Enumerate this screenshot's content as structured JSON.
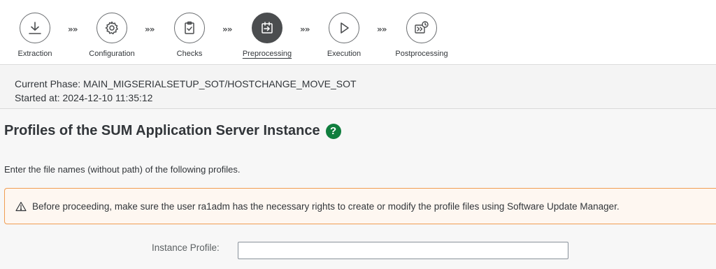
{
  "roadmap": {
    "steps": [
      {
        "label": "Extraction",
        "icon": "download-icon",
        "active": false
      },
      {
        "label": "Configuration",
        "icon": "gear-icon",
        "active": false
      },
      {
        "label": "Checks",
        "icon": "clipboard-check-icon",
        "active": false
      },
      {
        "label": "Preprocessing",
        "icon": "calendar-arrow-icon",
        "active": true
      },
      {
        "label": "Execution",
        "icon": "play-icon",
        "active": false
      },
      {
        "label": "Postprocessing",
        "icon": "postprocessing-clock-icon",
        "active": false
      }
    ],
    "separator": "»»"
  },
  "phase": {
    "current": "Current Phase: MAIN_MIGSERIALSETUP_SOT/HOSTCHANGE_MOVE_SOT",
    "started": "Started at: 2024-12-10 11:35:12"
  },
  "main": {
    "title": "Profiles of the SUM Application Server Instance",
    "help_glyph": "?",
    "intro": "Enter the file names (without path) of the following profiles.",
    "warning": "Before proceeding, make sure the user ra1adm has the necessary rights to create or modify the profile files using Software Update Manager.",
    "instance_profile_label": "Instance Profile:",
    "instance_profile_value": ""
  },
  "colors": {
    "active_step": "#4b4d4f",
    "help_badge": "#107e3e",
    "warning_border": "#f09d52",
    "warning_bg": "#fef7f1"
  }
}
